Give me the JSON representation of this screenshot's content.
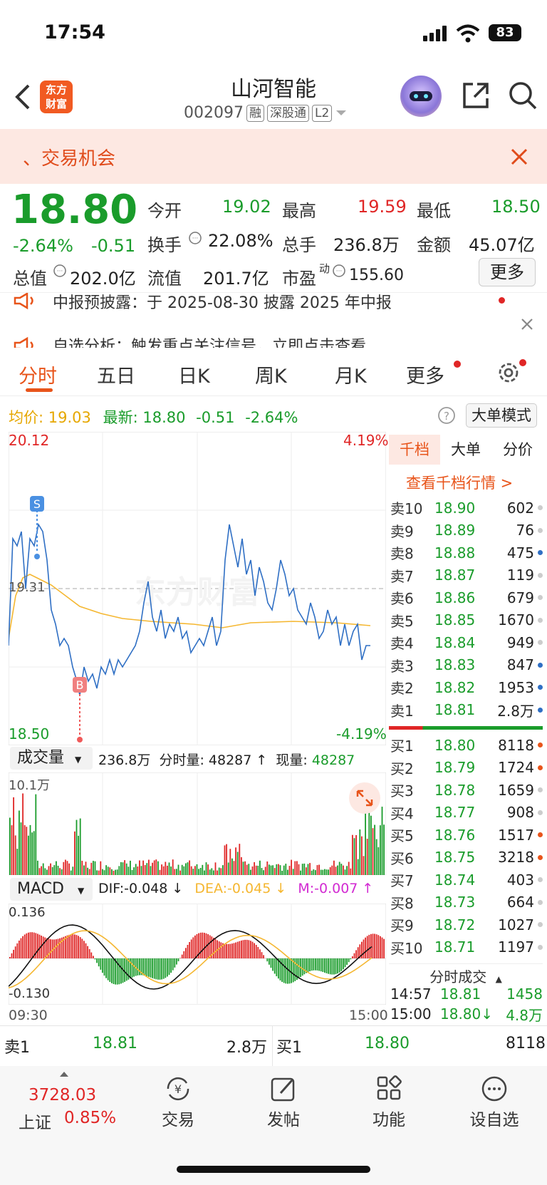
{
  "status": {
    "time": "17:54",
    "battery": "83"
  },
  "header": {
    "title": "山河智能",
    "code": "002097",
    "tags": [
      "融",
      "深股通",
      "L2"
    ],
    "logo_line1": "东方",
    "logo_line2": "财富"
  },
  "banner": {
    "text": "、交易机会"
  },
  "quote": {
    "price": "18.80",
    "pct": "-2.64%",
    "change": "-0.51",
    "open_label": "今开",
    "open": "19.02",
    "high_label": "最高",
    "high": "19.59",
    "low_label": "最低",
    "low": "18.50",
    "turnover_label": "换手",
    "turnover": "22.08%",
    "volume_label": "总手",
    "volume": "236.8万",
    "amount_label": "金额",
    "amount": "45.07亿",
    "mcap_label": "总值",
    "mcap": "202.0亿",
    "float_label": "流值",
    "float": "201.7亿",
    "pe_label": "市盈",
    "pe_sup": "动",
    "pe": "155.60",
    "more": "更多"
  },
  "news": [
    {
      "text": "中报预披露：于 2025-08-30 披露 2025 年中报"
    },
    {
      "text": "自选分析：触发重点关注信号，立即点击查看"
    }
  ],
  "tabs": [
    "分时",
    "五日",
    "日K",
    "周K",
    "月K",
    "更多"
  ],
  "info_bar": {
    "avg_label": "均价:",
    "avg": "19.03",
    "last_label": "最新:",
    "last": "18.80",
    "chg": "-0.51",
    "pct": "-2.64%",
    "mode": "大单模式"
  },
  "price_chart": {
    "y_top": "20.12",
    "y_bottom": "18.50",
    "pct_top": "4.19%",
    "pct_bottom": "-4.19%",
    "y_mid": "19.31",
    "watermark": "东方财富",
    "marker_s": "S",
    "marker_b": "B"
  },
  "volume_chart": {
    "selector": "成交量",
    "total": "236.8万",
    "minute_label": "分时量:",
    "minute": "48287",
    "current_label": "现量:",
    "current": "48287",
    "max": "10.1万"
  },
  "macd_chart": {
    "selector": "MACD",
    "dif": "DIF:-0.048",
    "dea": "DEA:-0.045",
    "m": "M:-0.007",
    "y_top": "0.136",
    "y_bottom": "-0.130",
    "x_start": "09:30",
    "x_end": "15:00"
  },
  "orderbook": {
    "tabs": [
      "千档",
      "大单",
      "分价"
    ],
    "link": "查看千档行情 >",
    "asks": [
      {
        "label": "卖10",
        "price": "18.90",
        "vol": "602"
      },
      {
        "label": "卖9",
        "price": "18.89",
        "vol": "76"
      },
      {
        "label": "卖8",
        "price": "18.88",
        "vol": "475"
      },
      {
        "label": "卖7",
        "price": "18.87",
        "vol": "119"
      },
      {
        "label": "卖6",
        "price": "18.86",
        "vol": "679"
      },
      {
        "label": "卖5",
        "price": "18.85",
        "vol": "1670"
      },
      {
        "label": "卖4",
        "price": "18.84",
        "vol": "949"
      },
      {
        "label": "卖3",
        "price": "18.83",
        "vol": "847"
      },
      {
        "label": "卖2",
        "price": "18.82",
        "vol": "1953"
      },
      {
        "label": "卖1",
        "price": "18.81",
        "vol": "2.8万"
      }
    ],
    "bids": [
      {
        "label": "买1",
        "price": "18.80",
        "vol": "8118"
      },
      {
        "label": "买2",
        "price": "18.79",
        "vol": "1724"
      },
      {
        "label": "买3",
        "price": "18.78",
        "vol": "1659"
      },
      {
        "label": "买4",
        "price": "18.77",
        "vol": "908"
      },
      {
        "label": "买5",
        "price": "18.76",
        "vol": "1517"
      },
      {
        "label": "买6",
        "price": "18.75",
        "vol": "3218"
      },
      {
        "label": "买7",
        "price": "18.74",
        "vol": "403"
      },
      {
        "label": "买8",
        "price": "18.73",
        "vol": "664"
      },
      {
        "label": "买9",
        "price": "18.72",
        "vol": "1027"
      },
      {
        "label": "买10",
        "price": "18.71",
        "vol": "1197"
      }
    ],
    "trades_title": "分时成交",
    "trades": [
      {
        "time": "14:57",
        "price": "18.81",
        "vol": "1458"
      },
      {
        "time": "15:00",
        "price": "18.80↓",
        "vol": "4.8万"
      }
    ]
  },
  "bottom_quote": {
    "ask_label": "卖1",
    "ask_price": "18.81",
    "ask_vol": "2.8万",
    "bid_label": "买1",
    "bid_price": "18.80",
    "bid_vol": "8118"
  },
  "bottom_nav": {
    "index_value": "3728.03",
    "index_name": "上证",
    "index_pct": "0.85%",
    "items": [
      "交易",
      "发帖",
      "功能",
      "设自选"
    ]
  }
}
